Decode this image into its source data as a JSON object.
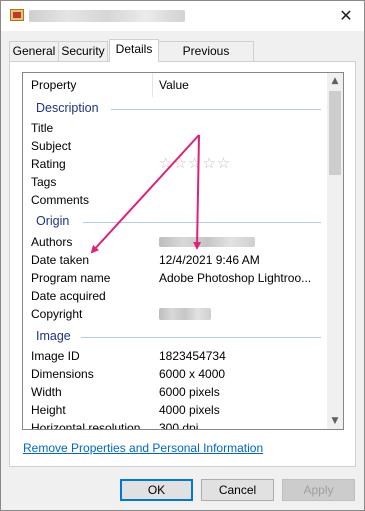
{
  "window": {
    "close_glyph": "✕"
  },
  "tabs": [
    {
      "label": "General"
    },
    {
      "label": "Security"
    },
    {
      "label": "Details"
    },
    {
      "label": "Previous Versions"
    }
  ],
  "columns": {
    "property": "Property",
    "value": "Value"
  },
  "groups": {
    "description": {
      "label": "Description",
      "rows": {
        "title": "Title",
        "subject": "Subject",
        "rating": "Rating",
        "tags": "Tags",
        "comments": "Comments"
      },
      "rating_stars": "☆☆☆☆☆"
    },
    "origin": {
      "label": "Origin",
      "rows": {
        "authors": "Authors",
        "date_taken": "Date taken",
        "date_taken_value": "12/4/2021 9:46 AM",
        "program_name": "Program name",
        "program_name_value": "Adobe Photoshop Lightroo...",
        "date_acquired": "Date acquired",
        "copyright": "Copyright"
      }
    },
    "image": {
      "label": "Image",
      "rows": {
        "image_id": "Image ID",
        "image_id_value": "1823454734",
        "dimensions": "Dimensions",
        "dimensions_value": "6000 x 4000",
        "width": "Width",
        "width_value": "6000 pixels",
        "height": "Height",
        "height_value": "4000 pixels",
        "horizontal_resolution": "Horizontal resolution",
        "horizontal_resolution_value": "300 dpi"
      }
    }
  },
  "scrollbar": {
    "up_glyph": "▲",
    "down_glyph": "▼"
  },
  "remove_link": "Remove Properties and Personal Information",
  "buttons": {
    "ok": "OK",
    "cancel": "Cancel",
    "apply": "Apply"
  },
  "colors": {
    "annotation_arrow": "#e0207a",
    "group_heading": "#1e3287",
    "link": "#0066cc",
    "focus_border": "#0078d7"
  }
}
